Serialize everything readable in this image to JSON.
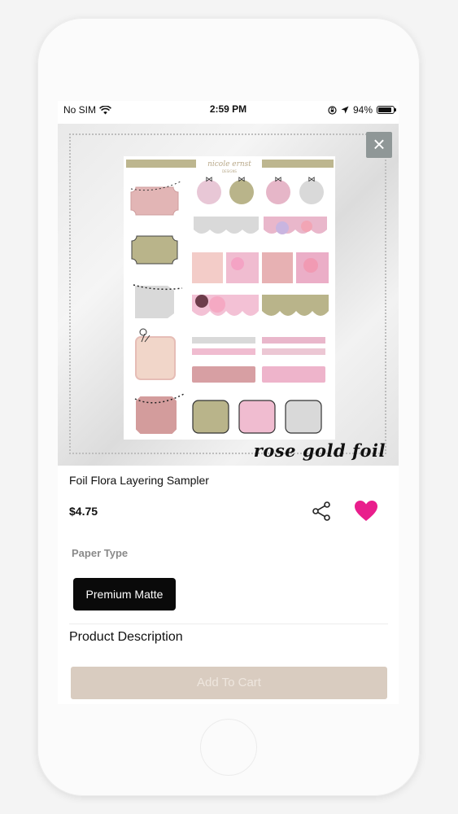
{
  "status_bar": {
    "carrier": "No SIM",
    "time": "2:59 PM",
    "battery": "94%"
  },
  "product": {
    "title": "Foil Flora Layering Sampler",
    "price": "$4.75",
    "image_caption": "rose gold foil",
    "brand_text": "nicole ernst"
  },
  "options": {
    "label": "Paper Type",
    "selected": "Premium Matte"
  },
  "description_heading": "Product Description",
  "cart_button": "Add To Cart",
  "icons": {
    "close": "close-icon",
    "share": "share-icon",
    "favorite": "heart-icon",
    "wifi": "wifi-icon",
    "location": "location-arrow-icon",
    "lock": "orientation-lock-icon",
    "battery": "battery-icon"
  },
  "colors": {
    "heart": "#e91e8c",
    "option_bg": "#0a0a0a",
    "cart_bg": "#d9ccc0",
    "sticker_pink": "#e8b8b6",
    "sticker_olive": "#b9b48a",
    "sticker_grey": "#d9d9d9",
    "close_bg": "#8f9797"
  }
}
